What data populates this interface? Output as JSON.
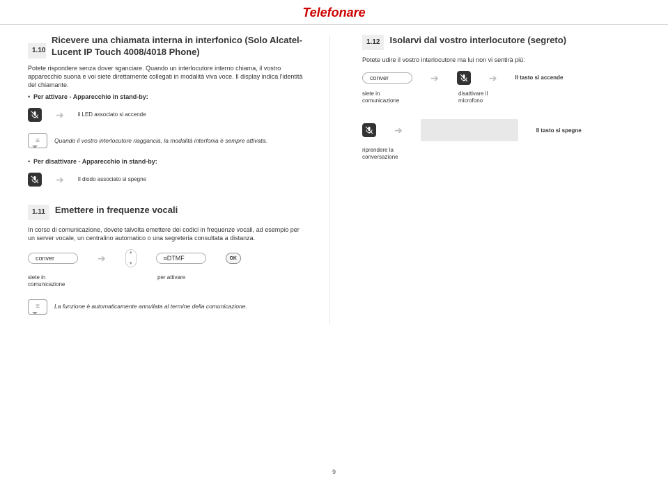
{
  "page_title": "Telefonare",
  "page_number": "9",
  "left": {
    "sec110": {
      "num": "1.10",
      "title": "Ricevere una chiamata interna in interfonico (Solo Alcatel-Lucent IP Touch 4008/4018 Phone)",
      "intro": "Potete rispondere senza dover sganciare. Quando un interlocutore interno chiama, il vostro apparecchio suona e voi siete direttamente collegati in modalità viva voce. Il display indica l'identità del chiamante.",
      "enable_label": "Per attivare - Apparecchio in stand-by:",
      "led_on": "il LED associato si accende",
      "note": "Quando il vostro interlocutore riaggancia, la modalità interfonia è sempre attivata.",
      "disable_label": "Per disattivare - Apparecchio in stand-by:",
      "led_off": "Il diodo associato si spegne"
    },
    "sec111": {
      "num": "1.11",
      "title": "Emettere in frequenze vocali",
      "intro": "In corso di comunicazione, dovete talvolta emettere dei codici in frequenze vocali, ad esempio per un server vocale, un centralino automatico o una segreteria consultata a distanza.",
      "pill1": "conver",
      "pill2": "¤DTMF",
      "ok": "OK",
      "caption_left": "siete in comunicazione",
      "caption_mid": "per attivare",
      "note": "La funzione è automaticamente annullata al termine della comunicazione."
    }
  },
  "right": {
    "sec112": {
      "num": "1.12",
      "title": "Isolarvi dal vostro interlocutore (segreto)",
      "intro": "Potete udire il vostro interlocutore ma lui non vi sentirà più:",
      "pill": "conver",
      "key_on": "Il tasto si accende",
      "caption_left": "siete in comunicazione",
      "caption_mid": "disattivare il microfono",
      "key_off": "Il tasto si spegne",
      "caption_resume": "riprendere la conversazione"
    }
  }
}
